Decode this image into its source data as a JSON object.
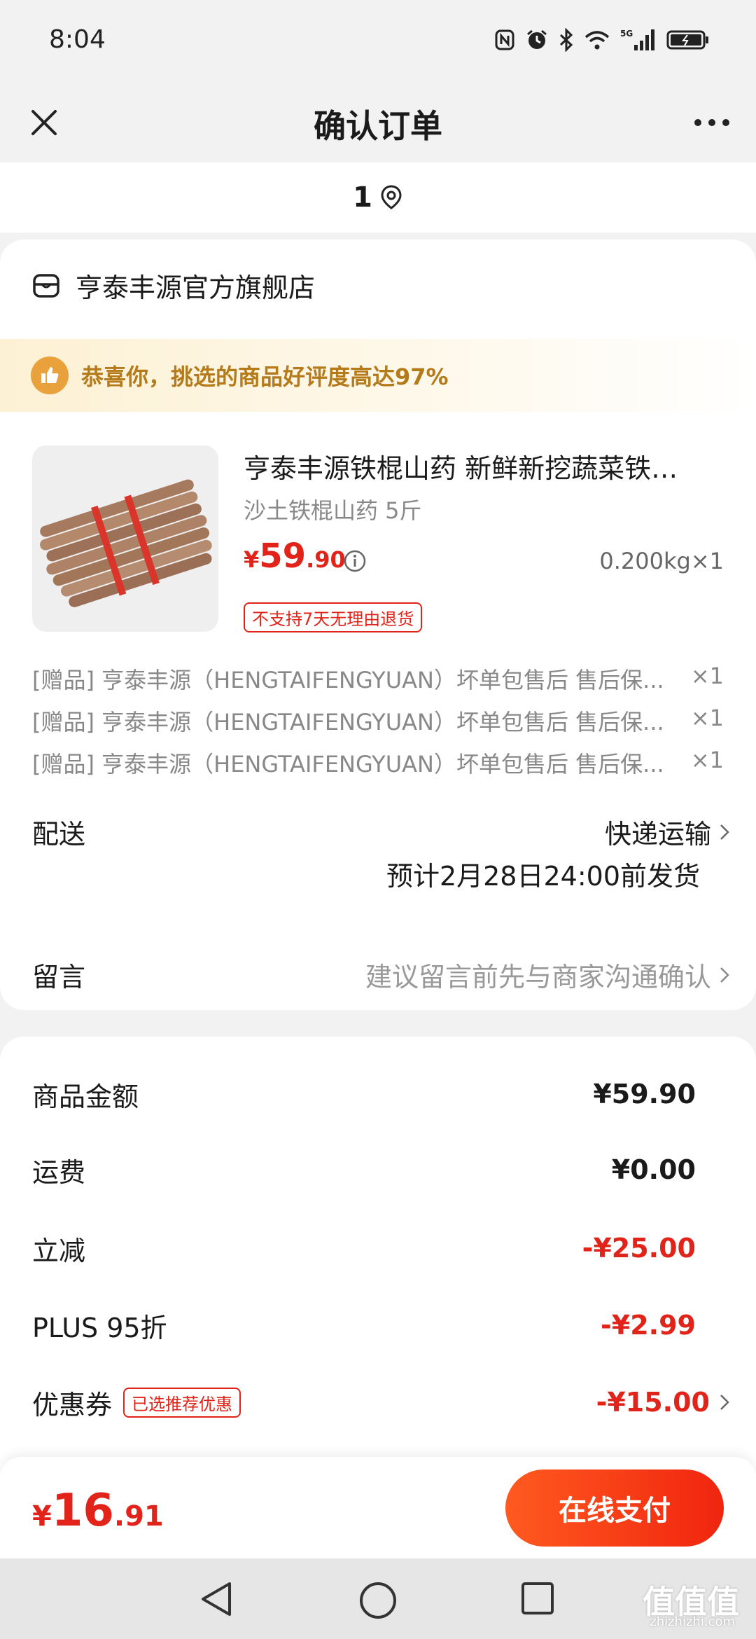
{
  "status_bar": {
    "time": "8:04",
    "network": "5G"
  },
  "nav": {
    "title": "确认订单",
    "close_icon": "close-icon",
    "more_icon": "more-icon"
  },
  "address": {
    "text": "1",
    "icon": "location-pin-icon"
  },
  "shop": {
    "name": "亨泰丰源官方旗舰店",
    "icon": "store-icon"
  },
  "promo": {
    "text": "恭喜你，挑选的商品好评度高达97%",
    "icon": "thumbs-up-icon",
    "accent": "#e9a23b"
  },
  "product": {
    "title": "亨泰丰源铁棍山药 新鲜新挖蔬菜铁…",
    "spec": "沙土铁棍山药 5斤",
    "price_symbol": "¥",
    "price_int": "59",
    "price_dec": ".90",
    "weight_qty": "0.200kg×1",
    "return_tag": "不支持7天无理由退货"
  },
  "gifts": [
    {
      "text": "[赠品] 亨泰丰源（HENGTAIFENGYUAN）坏单包售后 售后保...",
      "qty": "×1"
    },
    {
      "text": "[赠品] 亨泰丰源（HENGTAIFENGYUAN）坏单包售后 售后保...",
      "qty": "×1"
    },
    {
      "text": "[赠品] 亨泰丰源（HENGTAIFENGYUAN）坏单包售后 售后保...",
      "qty": "×1"
    }
  ],
  "delivery": {
    "label": "配送",
    "method": "快递运输",
    "eta": "预计2月28日24:00前发货"
  },
  "message": {
    "label": "留言",
    "placeholder": "建议留言前先与商家沟通确认"
  },
  "costs": {
    "goods": {
      "label": "商品金额",
      "value": "¥59.90"
    },
    "shipping": {
      "label": "运费",
      "value": "¥0.00"
    },
    "discount": {
      "label": "立减",
      "value": "-¥25.00"
    },
    "plus": {
      "label": "PLUS 95折",
      "value": "-¥2.99"
    },
    "coupon": {
      "label": "优惠券",
      "tag": "已选推荐优惠",
      "value": "-¥15.00"
    }
  },
  "footer": {
    "total_symbol": "¥",
    "total_int": "16",
    "total_dec": ".91",
    "pay_label": "在线支付"
  },
  "colors": {
    "accent_red": "#e2231a",
    "pay_button": "#f0250f"
  },
  "watermark": {
    "main": "值值值",
    "sub": "zhizhizhi.com"
  }
}
